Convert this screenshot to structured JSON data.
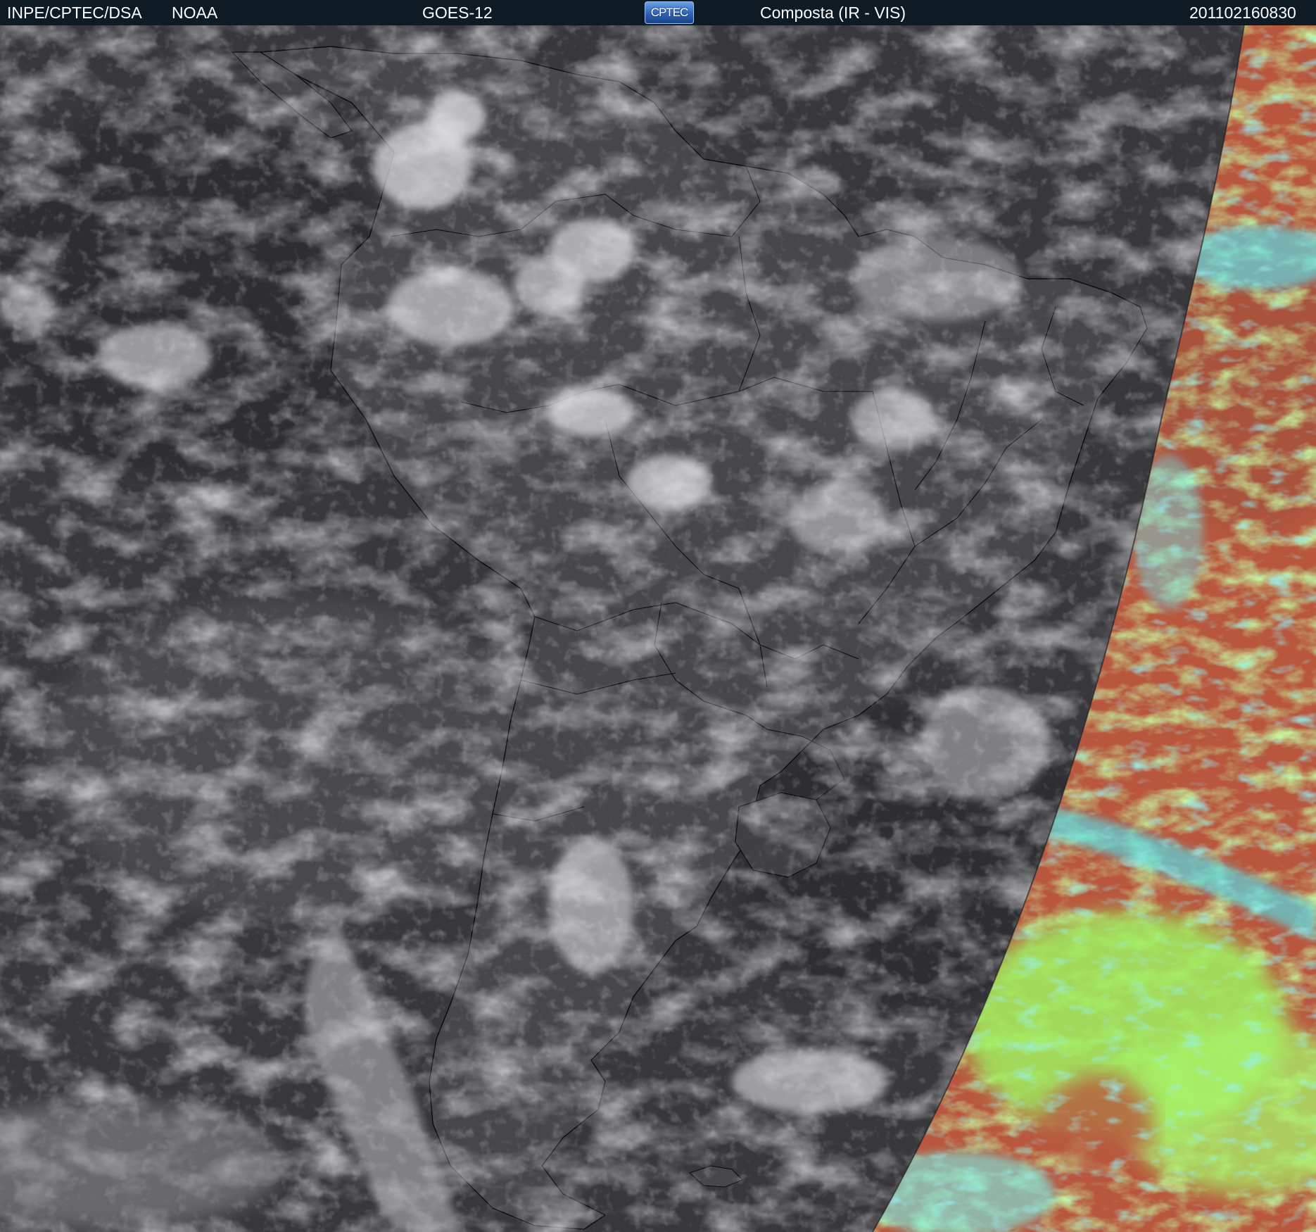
{
  "header": {
    "organization": "INPE/CPTEC/DSA",
    "agency": "NOAA",
    "satellite": "GOES-12",
    "logo_text": "CPTEC",
    "product": "Composta (IR - VIS)",
    "timestamp": "201102160830"
  },
  "map": {
    "region": "South America",
    "night_side_style": "grayscale infrared",
    "day_side_style": "false-color visible",
    "colors": {
      "header_bg": "#0e1a24",
      "ocean_ir": "#3b3b3f",
      "land_ir": "#4a4a4e",
      "cloud_ir": "#d8d8dc",
      "day_land": "#b5573d",
      "day_cloud_green": "#8ff05a",
      "day_cloud_cyan": "#4fe0e6",
      "outline": "#0a0a0a"
    }
  }
}
